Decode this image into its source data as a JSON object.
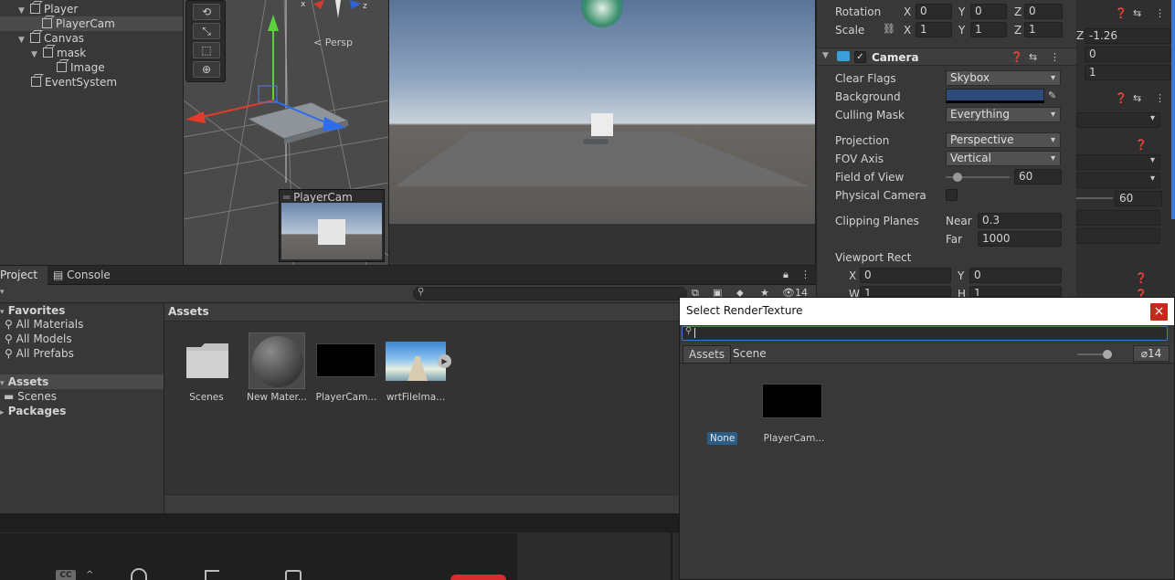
{
  "hierarchy": {
    "items": [
      {
        "label": "Player",
        "expanded": true
      },
      {
        "label": "PlayerCam",
        "selected": true
      },
      {
        "label": "Canvas",
        "expanded": true
      },
      {
        "label": "mask",
        "expanded": true
      },
      {
        "label": "Image"
      },
      {
        "label": "EventSystem"
      }
    ]
  },
  "scene": {
    "persp_label": "< Persp",
    "axis_x": "x",
    "axis_z": "z",
    "camera_preview_title": "PlayerCam"
  },
  "inspector": {
    "transform": {
      "rotation_label": "Rotation",
      "scale_label": "Scale",
      "rotation": {
        "x": "0",
        "y": "0",
        "z": "0"
      },
      "scale": {
        "x": "1",
        "y": "1",
        "z": "1"
      }
    },
    "camera": {
      "title": "Camera",
      "clear_flags_label": "Clear Flags",
      "clear_flags": "Skybox",
      "background_label": "Background",
      "background_color": "#2c4a7a",
      "culling_mask_label": "Culling Mask",
      "culling_mask": "Everything",
      "projection_label": "Projection",
      "projection": "Perspective",
      "fov_axis_label": "FOV Axis",
      "fov_axis": "Vertical",
      "fov_label": "Field of View",
      "fov": "60",
      "fov_slider_fraction": 0.18,
      "physical_label": "Physical Camera",
      "clipping_label": "Clipping Planes",
      "near_label": "Near",
      "near": "0.3",
      "far_label": "Far",
      "far": "1000",
      "viewport_label": "Viewport Rect",
      "vp": {
        "x_label": "X",
        "x": "0",
        "y_label": "Y",
        "y": "0",
        "w_label": "W",
        "w": "1",
        "h_label": "H",
        "h": "1"
      }
    },
    "axis_labels": {
      "x": "X",
      "y": "Y",
      "z": "Z"
    }
  },
  "inspector_right": {
    "z_label": "Z",
    "z": "-1.26",
    "v2": "0",
    "v3": "1",
    "fov": "60"
  },
  "project": {
    "tab_project": "Project",
    "tab_console": "Console",
    "hidden_count": "14",
    "favorites_label": "Favorites",
    "favorites": [
      "All Materials",
      "All Models",
      "All Prefabs"
    ],
    "assets_label": "Assets",
    "scenes_label": "Scenes",
    "packages_label": "Packages",
    "breadcrumb": "Assets",
    "items": [
      {
        "name": "Scenes",
        "kind": "folder"
      },
      {
        "name": "New Mater...",
        "kind": "material"
      },
      {
        "name": "PlayerCam...",
        "kind": "rendertexture"
      },
      {
        "name": "wrtFileIma...",
        "kind": "image"
      }
    ]
  },
  "select_window": {
    "title": "Select RenderTexture",
    "close": "×",
    "search_value": "",
    "tab_assets": "Assets",
    "tab_scene": "Scene",
    "hidden_count": "14",
    "items": [
      {
        "name": "None",
        "selected": true
      },
      {
        "name": "PlayerCam..."
      }
    ]
  },
  "taskbar": {
    "cc_label": "CC"
  }
}
